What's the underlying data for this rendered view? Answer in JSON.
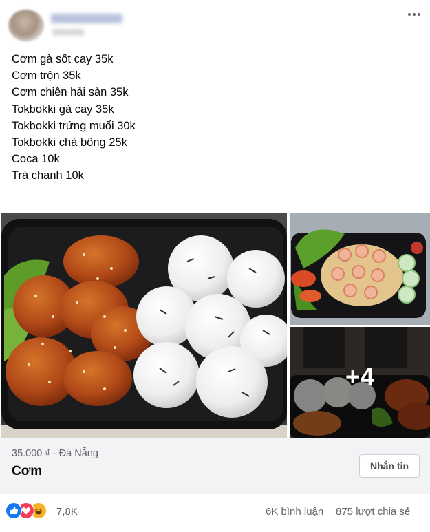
{
  "post": {
    "lines": [
      "Cơm gà sốt cay 35k",
      "Cơm trộn 35k",
      "Cơm chiên hải sản 35k",
      "Tokbokki gà cay 35k",
      "Tokbokki trứng muối 30k",
      "Tokbokki chà bông 25k",
      "Coca 10k",
      "Trà chanh 10k"
    ]
  },
  "photos": {
    "more_count": "+4"
  },
  "listing": {
    "price_location": "35.000 ₫ · Đà Nẵng",
    "title": "Cơm",
    "message_button": "Nhắn tin"
  },
  "footer": {
    "reaction_count": "7,8K",
    "comments": "6K bình luận",
    "shares": "875 lượt chia sẻ"
  },
  "icons": [
    "more-options-icon",
    "like-reaction-icon",
    "love-reaction-icon",
    "haha-reaction-icon"
  ],
  "colors": {
    "like": "#1877f2",
    "love": "#f33e58",
    "haha": "#f7b125",
    "secondary_text": "#65676b"
  }
}
